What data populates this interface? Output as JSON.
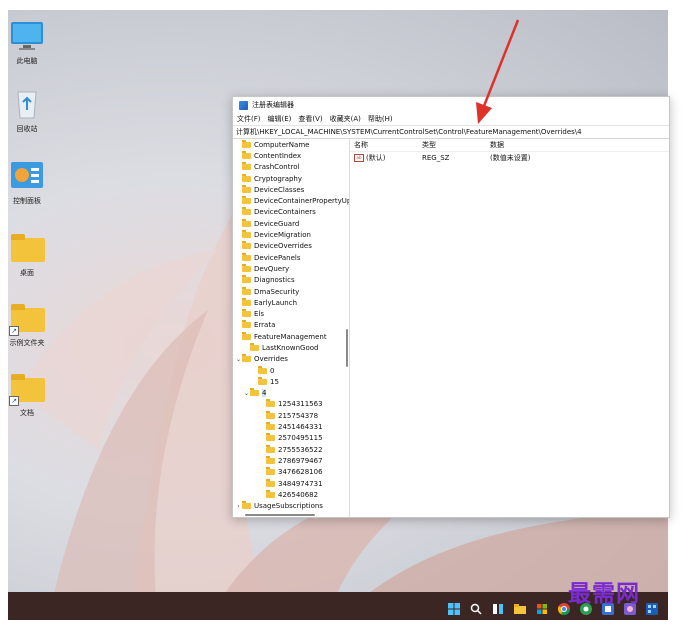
{
  "desktop": {
    "icons": [
      {
        "name": "此电脑",
        "type": "monitor"
      },
      {
        "name": "回收站",
        "type": "recycle-bin"
      },
      {
        "name": "控制面板",
        "type": "control-panel"
      },
      {
        "name": "桌面",
        "type": "folder"
      },
      {
        "name": "示例文件夹",
        "type": "folder-shortcut"
      },
      {
        "name": "文档",
        "type": "folder-shortcut"
      }
    ]
  },
  "window": {
    "title": "注册表编辑器",
    "menu": [
      "文件(F)",
      "编辑(E)",
      "查看(V)",
      "收藏夹(A)",
      "帮助(H)"
    ],
    "address": "计算机\\HKEY_LOCAL_MACHINE\\SYSTEM\\CurrentControlSet\\Control\\FeatureManagement\\Overrides\\4"
  },
  "tree": {
    "top_items": [
      "ComputerName",
      "ContentIndex",
      "CrashControl",
      "Cryptography",
      "DeviceClasses",
      "DeviceContainerPropertyUpda",
      "DeviceContainers",
      "DeviceGuard",
      "DeviceMigration",
      "DeviceOverrides",
      "DevicePanels",
      "DevQuery",
      "Diagnostics",
      "DmaSecurity",
      "EarlyLaunch",
      "Els",
      "Errata",
      "FeatureManagement"
    ],
    "last_known_good": "LastKnownGood",
    "overrides": "Overrides",
    "override_keys": [
      "0",
      "15"
    ],
    "selected": "4",
    "subkeys": [
      "1254311563",
      "215754378",
      "2451464331",
      "2570495115",
      "2755536522",
      "2786979467",
      "3476628106",
      "3484974731",
      "426540682"
    ],
    "cut_off": "UsageSubscriptions"
  },
  "values": {
    "headers": {
      "name": "名称",
      "type": "类型",
      "data": "数据"
    },
    "rows": [
      {
        "name": "(默认)",
        "type": "REG_SZ",
        "data": "(数值未设置)"
      }
    ]
  },
  "watermark": "最需网",
  "colors": {
    "arrow": "#e0302a",
    "taskbar": "#3b2624",
    "watermark": "#7a2bd0"
  }
}
